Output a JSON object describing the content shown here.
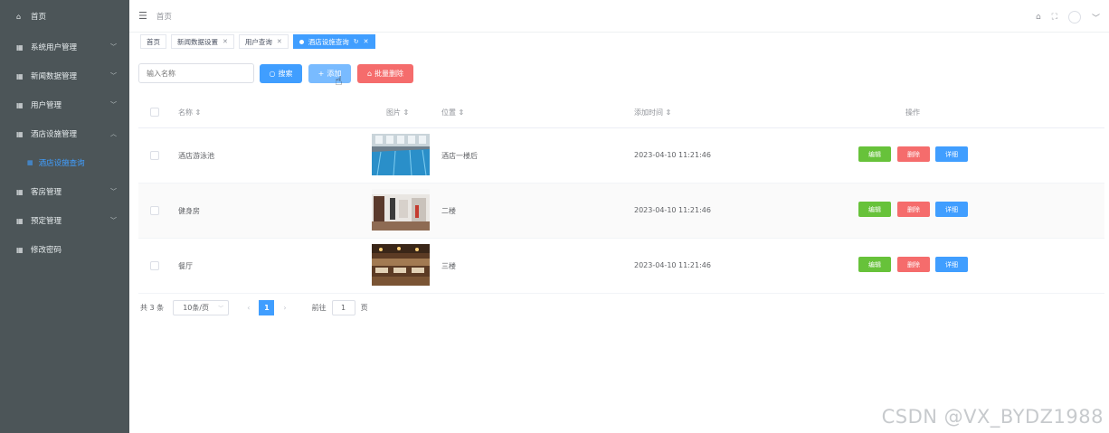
{
  "sidebar": {
    "home": "首页",
    "items": [
      {
        "label": "系统用户管理",
        "expanded": false
      },
      {
        "label": "新闻数据管理",
        "expanded": false
      },
      {
        "label": "用户管理",
        "expanded": false
      },
      {
        "label": "酒店设施管理",
        "expanded": true
      },
      {
        "label": "客房管理",
        "expanded": false
      },
      {
        "label": "预定管理",
        "expanded": false
      },
      {
        "label": "修改密码",
        "expanded": false
      }
    ],
    "subitem": "酒店设施查询"
  },
  "topbar": {
    "breadcrumb": "首页"
  },
  "tabs": [
    {
      "label": "首页",
      "closable": false,
      "active": false
    },
    {
      "label": "新闻数据设置",
      "closable": true,
      "active": false
    },
    {
      "label": "用户查询",
      "closable": true,
      "active": false
    },
    {
      "label": "酒店设施查询",
      "closable": true,
      "active": true
    }
  ],
  "toolbar": {
    "search_placeholder": "输入名称",
    "search_label": "搜索",
    "add_label": "添加",
    "batch_delete_label": "批量删除"
  },
  "table": {
    "columns": [
      "名称",
      "图片",
      "位置",
      "添加时间",
      "操作"
    ],
    "rows": [
      {
        "name": "酒店游泳池",
        "image": "swimming-pool",
        "location": "酒店一楼后",
        "time": "2023-04-10 11:21:46"
      },
      {
        "name": "健身房",
        "image": "gym",
        "location": "二楼",
        "time": "2023-04-10 11:21:46"
      },
      {
        "name": "餐厅",
        "image": "restaurant",
        "location": "三楼",
        "time": "2023-04-10 11:21:46"
      }
    ],
    "actions": {
      "edit": "编辑",
      "delete": "删除",
      "detail": "详细"
    }
  },
  "pagination": {
    "total": "共 3 条",
    "page_size": "10条/页",
    "current_page": "1",
    "goto_label": "前往",
    "goto_value": "1",
    "page_suffix": "页"
  },
  "watermark": "CSDN @VX_BYDZ1988",
  "colors": {
    "sidebar": "#4c5558",
    "primary": "#409eff",
    "success": "#67c23a",
    "danger": "#f56c6c"
  }
}
